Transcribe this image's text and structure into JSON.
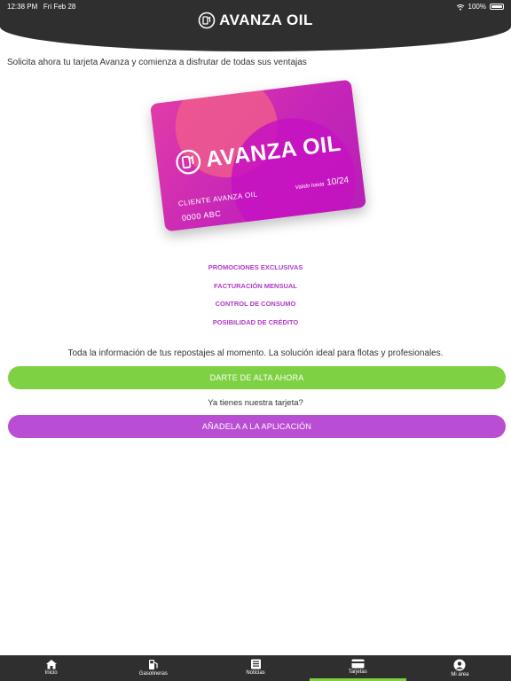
{
  "status_bar": {
    "time": "12:38 PM",
    "date": "Fri Feb 28",
    "battery": "100%",
    "battery_level": 1.0
  },
  "header": {
    "brand": "AVANZA OIL"
  },
  "intro": "Solicita ahora tu tarjeta Avanza y comienza a disfrutar de todas sus ventajas",
  "card": {
    "brand": "AVANZA OIL",
    "client": "CLIENTE AVANZA OIL",
    "number": "0000 ABC",
    "valid_label": "Valido hasta",
    "valid_date": "10/24"
  },
  "features": [
    "PROMOCIONES EXCLUSIVAS",
    "FACTURACIÓN MENSUAL",
    "CONTROL DE CONSUMO",
    "POSIBILIDAD DE CRÉDITO"
  ],
  "info": "Toda la información de tus repostajes al momento. La solución ideal para flotas y profesionales.",
  "buttons": {
    "signup": "DARTE DE ALTA AHORA",
    "add": "AÑADELA A LA APLICACIÓN"
  },
  "question": "Ya tienes nuestra tarjeta?",
  "colors": {
    "accent_green": "#7ed143",
    "accent_purple": "#b94dd3",
    "header_bg": "#2f2f2f"
  },
  "tabs": [
    {
      "label": "Inicio",
      "icon": "home-icon"
    },
    {
      "label": "Gasolineras",
      "icon": "fuel-pump-icon"
    },
    {
      "label": "Noticias",
      "icon": "news-icon"
    },
    {
      "label": "Tarjetas",
      "icon": "card-icon",
      "active": true
    },
    {
      "label": "Mi area",
      "icon": "user-icon"
    }
  ]
}
